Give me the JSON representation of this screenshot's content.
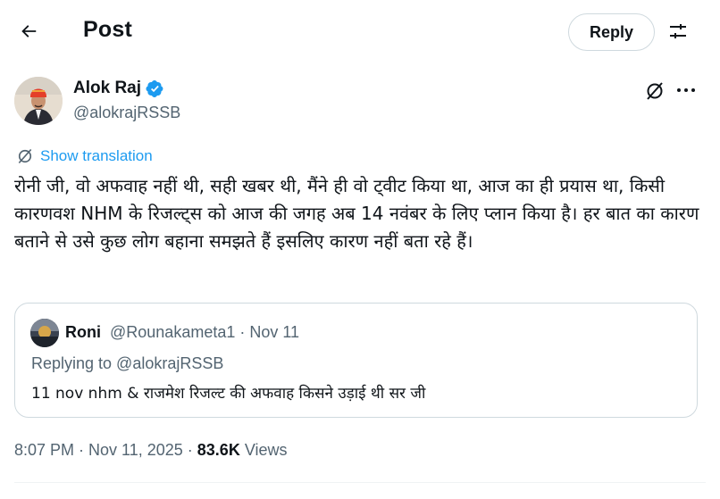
{
  "header": {
    "title": "Post",
    "back_icon": "arrow-left-icon",
    "reply_label": "Reply",
    "settings_icon": "sliders-icon"
  },
  "author": {
    "name": "Alok Raj",
    "handle": "@alokrajRSSB",
    "verified_color": "#1d9bf0"
  },
  "post": {
    "show_translation": "Show translation",
    "text": "रोनी जी, वो अफवाह नहीं थी, सही खबर थी, मैंने ही वो ट्वीट किया था, आज का ही प्रयास था, किसी कारणवश NHM के रिजल्ट्स को आज की जगह अब 14 नवंबर के लिए प्लान किया है। हर बात का कारण बताने से उसे कुछ लोग बहाना समझते हैं इसलिए कारण नहीं बता रहे हैं।"
  },
  "quote": {
    "name": "Roni",
    "handle_date": "@Rounakameta1 · Nov 11",
    "replying_to": "Replying to @alokrajRSSB",
    "text": "11 nov nhm & राजमेश रिजल्ट की अफवाह किसने उड़ाई थी सर जी"
  },
  "meta": {
    "timestamp": "8:07 PM · Nov 11, 2025 · ",
    "views_count": "83.6K",
    "views_label": " Views"
  },
  "colors": {
    "accent": "#1d9bf0",
    "secondary_text": "#536471",
    "border": "#cfd9de"
  }
}
